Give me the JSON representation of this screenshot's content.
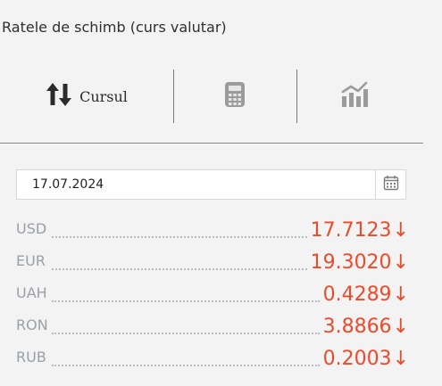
{
  "widget": {
    "title": "Ratele de schimb (curs valutar)"
  },
  "tabs": [
    {
      "label": "Cursul",
      "icon": "up-down-arrows-icon"
    },
    {
      "label": "",
      "icon": "calculator-icon"
    },
    {
      "label": "",
      "icon": "chart-icon"
    }
  ],
  "date": {
    "value": "17.07.2024",
    "icon": "calendar-icon"
  },
  "rates": [
    {
      "code": "USD",
      "value": "17.7123",
      "trend": "↓"
    },
    {
      "code": "EUR",
      "value": "19.3020",
      "trend": "↓"
    },
    {
      "code": "UAH",
      "value": "0.4289",
      "trend": "↓"
    },
    {
      "code": "RON",
      "value": "3.8866",
      "trend": "↓"
    },
    {
      "code": "RUB",
      "value": "0.2003",
      "trend": "↓"
    }
  ],
  "colors": {
    "rate": "#ea4b2a",
    "code": "#9aa0a6",
    "background": "#f3f3f3"
  }
}
